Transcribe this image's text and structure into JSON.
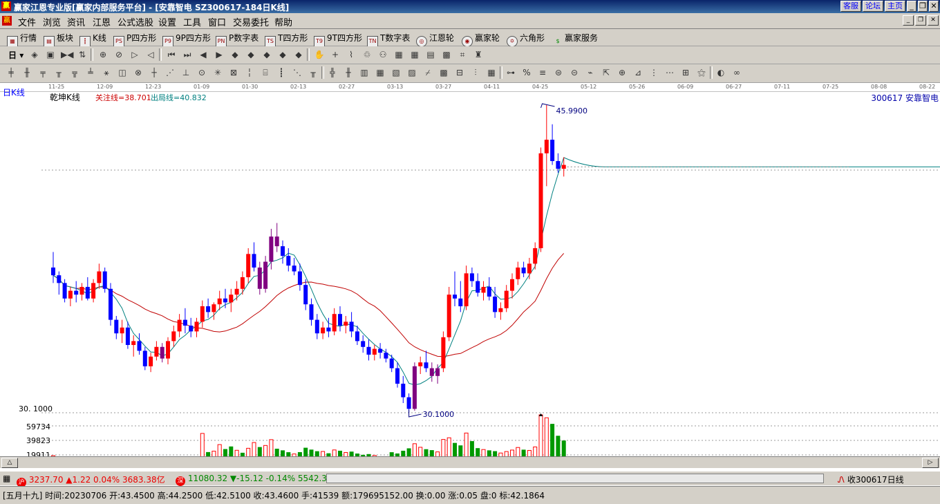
{
  "window": {
    "title": "赢家江恩专业版[赢家内部服务平台] - [安靠智电  SZ300617-184日K线]",
    "right_buttons": [
      "客服",
      "论坛",
      "主页"
    ]
  },
  "menu": [
    "文件",
    "浏览",
    "资讯",
    "江恩",
    "公式选股",
    "设置",
    "工具",
    "窗口",
    "交易委托",
    "帮助"
  ],
  "toolbar1": [
    "行情",
    "板块",
    "K线",
    "P四方形",
    "9P四方形",
    "P数字表",
    "T四方形",
    "9T四方形",
    "T数字表",
    "江恩轮",
    "赢家轮",
    "六角形",
    "赢家服务"
  ],
  "toolbar1_icons": [
    "grid-icon",
    "blocks-icon",
    "kline-icon",
    "p-square-icon",
    "9p-square-icon",
    "p-number-icon",
    "t-square-icon",
    "9t-square-icon",
    "t-number-icon",
    "gann-wheel-icon",
    "winner-wheel-icon",
    "hexagon-icon",
    "service-icon"
  ],
  "toolbar2": {
    "period": "日"
  },
  "dates": [
    "11-25",
    "12-09",
    "12-23",
    "01-09",
    "01-30",
    "02-13",
    "02-27",
    "03-13",
    "03-27",
    "04-11",
    "04-25",
    "05-12",
    "05-26",
    "06-09",
    "06-27",
    "07-11",
    "07-25",
    "08-08",
    "08-22"
  ],
  "chart": {
    "period_label": "日K线",
    "style_label": "乾坤K线",
    "attention_line": "关注线=38.701",
    "exit_line": "出局线=40.832",
    "stock": "300617 安靠智电",
    "high_label": "45.9900",
    "low_label": "30.1000",
    "low_axis_label": "30. 1000",
    "vol_ticks": [
      "59734",
      "39823",
      "19911"
    ]
  },
  "colors": {
    "up": "#ff0000",
    "down": "#0000ff",
    "neutral": "#800080",
    "ma_long": "#c00000",
    "ma_short": "#008080",
    "vol_up": "#ff0000",
    "vol_down": "#009900"
  },
  "chart_data": {
    "type": "candlestick",
    "price_range": [
      30.1,
      45.99
    ],
    "ma_labels": {
      "attention": 38.701,
      "exit": 40.832
    },
    "candles": [
      [
        37.6,
        38.4,
        36.8,
        37.2
      ],
      [
        37.2,
        37.4,
        36.2,
        36.8
      ],
      [
        36.8,
        37.0,
        35.8,
        36.0
      ],
      [
        36.0,
        36.6,
        35.6,
        36.4
      ],
      [
        36.4,
        36.9,
        35.8,
        36.2
      ],
      [
        36.2,
        36.8,
        35.9,
        36.6
      ],
      [
        36.6,
        37.1,
        35.9,
        36.0
      ],
      [
        36.0,
        37.0,
        35.8,
        36.8
      ],
      [
        36.8,
        37.8,
        36.5,
        37.4
      ],
      [
        37.4,
        37.6,
        36.3,
        36.5
      ],
      [
        36.5,
        36.8,
        34.6,
        34.9
      ],
      [
        34.9,
        35.1,
        33.9,
        34.2
      ],
      [
        34.2,
        34.9,
        33.7,
        34.5
      ],
      [
        34.5,
        34.8,
        33.4,
        33.6
      ],
      [
        33.6,
        34.1,
        33.0,
        33.8
      ],
      [
        33.8,
        34.2,
        33.1,
        33.3
      ],
      [
        33.3,
        33.5,
        32.3,
        32.5
      ],
      [
        32.5,
        33.2,
        32.2,
        33.0
      ],
      [
        33.0,
        33.8,
        32.8,
        33.5
      ],
      [
        33.5,
        33.7,
        32.7,
        32.9
      ],
      [
        32.9,
        34.0,
        32.6,
        33.8
      ],
      [
        33.8,
        34.6,
        33.5,
        34.3
      ],
      [
        34.3,
        35.2,
        34.0,
        34.9
      ],
      [
        34.9,
        35.5,
        34.2,
        34.6
      ],
      [
        34.6,
        35.0,
        34.0,
        34.3
      ],
      [
        34.3,
        35.0,
        34.0,
        34.8
      ],
      [
        34.8,
        35.9,
        34.5,
        35.6
      ],
      [
        35.6,
        36.0,
        35.0,
        35.3
      ],
      [
        35.3,
        35.8,
        34.9,
        35.7
      ],
      [
        35.7,
        36.4,
        35.4,
        36.0
      ],
      [
        36.0,
        36.5,
        35.5,
        35.8
      ],
      [
        35.8,
        36.5,
        35.3,
        36.2
      ],
      [
        36.2,
        36.9,
        35.9,
        36.5
      ],
      [
        36.5,
        37.4,
        36.2,
        37.1
      ],
      [
        37.1,
        38.6,
        36.8,
        38.3
      ],
      [
        38.3,
        38.9,
        37.4,
        37.6
      ],
      [
        37.6,
        37.9,
        36.2,
        36.5
      ],
      [
        36.5,
        38.2,
        36.3,
        37.9
      ],
      [
        37.9,
        39.6,
        37.5,
        39.2
      ],
      [
        39.2,
        39.9,
        38.4,
        38.7
      ],
      [
        38.7,
        39.0,
        37.8,
        38.2
      ],
      [
        38.2,
        38.6,
        37.4,
        37.7
      ],
      [
        37.7,
        38.1,
        37.2,
        37.4
      ],
      [
        37.4,
        37.8,
        36.4,
        36.7
      ],
      [
        36.7,
        37.0,
        35.4,
        35.7
      ],
      [
        35.7,
        36.0,
        34.6,
        34.9
      ],
      [
        34.9,
        35.2,
        33.9,
        34.2
      ],
      [
        34.2,
        34.8,
        33.9,
        34.5
      ],
      [
        34.5,
        35.0,
        34.0,
        34.3
      ],
      [
        34.3,
        35.5,
        34.1,
        35.2
      ],
      [
        35.2,
        35.6,
        34.3,
        34.6
      ],
      [
        34.6,
        35.1,
        34.2,
        34.8
      ],
      [
        34.8,
        35.3,
        34.0,
        34.3
      ],
      [
        34.3,
        34.6,
        33.6,
        33.8
      ],
      [
        33.8,
        34.1,
        33.2,
        33.5
      ],
      [
        33.5,
        33.9,
        32.8,
        33.1
      ],
      [
        33.1,
        33.6,
        32.8,
        33.4
      ],
      [
        33.4,
        33.7,
        32.9,
        33.2
      ],
      [
        33.2,
        33.4,
        32.7,
        32.9
      ],
      [
        32.9,
        33.1,
        32.2,
        32.4
      ],
      [
        32.4,
        32.7,
        31.4,
        31.6
      ],
      [
        31.6,
        32.0,
        30.6,
        30.9
      ],
      [
        30.9,
        31.1,
        30.1,
        30.3
      ],
      [
        30.3,
        32.7,
        30.2,
        32.5
      ],
      [
        32.5,
        33.0,
        32.1,
        32.7
      ],
      [
        32.7,
        33.3,
        32.2,
        32.4
      ],
      [
        32.4,
        32.7,
        31.7,
        32.0
      ],
      [
        32.0,
        32.6,
        31.6,
        32.4
      ],
      [
        32.4,
        34.3,
        32.2,
        34.0
      ],
      [
        34.0,
        36.6,
        33.8,
        36.2
      ],
      [
        36.2,
        37.4,
        35.6,
        36.0
      ],
      [
        36.0,
        36.9,
        35.3,
        35.6
      ],
      [
        35.6,
        37.7,
        35.4,
        37.3
      ],
      [
        37.3,
        37.6,
        36.6,
        36.9
      ],
      [
        36.9,
        37.3,
        36.1,
        36.3
      ],
      [
        36.3,
        36.9,
        35.9,
        36.6
      ],
      [
        36.6,
        37.1,
        35.9,
        36.1
      ],
      [
        36.1,
        36.6,
        35.0,
        35.3
      ],
      [
        35.3,
        35.8,
        34.9,
        35.5
      ],
      [
        35.5,
        36.7,
        35.3,
        36.4
      ],
      [
        36.4,
        37.3,
        36.0,
        37.0
      ],
      [
        37.0,
        37.9,
        36.7,
        37.6
      ],
      [
        37.6,
        37.9,
        37.1,
        37.3
      ],
      [
        37.3,
        38.1,
        37.0,
        37.8
      ],
      [
        37.8,
        38.9,
        37.5,
        38.6
      ],
      [
        38.6,
        43.8,
        38.4,
        43.5
      ],
      [
        43.5,
        45.99,
        41.8,
        44.2
      ],
      [
        44.2,
        45.0,
        42.9,
        43.1
      ],
      [
        43.1,
        43.5,
        42.5,
        42.7
      ],
      [
        42.7,
        43.3,
        42.3,
        42.9
      ]
    ],
    "volume_max": 79646,
    "volumes": [
      [
        18500,
        1
      ],
      [
        15200,
        0
      ],
      [
        13800,
        0
      ],
      [
        12500,
        1
      ],
      [
        11000,
        0
      ],
      [
        13200,
        1
      ],
      [
        12100,
        0
      ],
      [
        15500,
        1
      ],
      [
        16800,
        1
      ],
      [
        14600,
        0
      ],
      [
        15800,
        0
      ],
      [
        14300,
        0
      ],
      [
        13900,
        1
      ],
      [
        14100,
        0
      ],
      [
        12400,
        1
      ],
      [
        15000,
        0
      ],
      [
        14700,
        0
      ],
      [
        13100,
        1
      ],
      [
        13600,
        1
      ],
      [
        11900,
        0
      ],
      [
        15600,
        1
      ],
      [
        16400,
        1
      ],
      [
        14900,
        1
      ],
      [
        13500,
        0
      ],
      [
        12300,
        0
      ],
      [
        14400,
        1
      ],
      [
        51800,
        1
      ],
      [
        23900,
        0
      ],
      [
        25300,
        1
      ],
      [
        35100,
        1
      ],
      [
        28400,
        0
      ],
      [
        32300,
        0
      ],
      [
        26600,
        1
      ],
      [
        22900,
        0
      ],
      [
        29600,
        1
      ],
      [
        38200,
        1
      ],
      [
        31400,
        0
      ],
      [
        33800,
        1
      ],
      [
        42500,
        1
      ],
      [
        28900,
        0
      ],
      [
        26500,
        0
      ],
      [
        23700,
        0
      ],
      [
        21100,
        1
      ],
      [
        23800,
        0
      ],
      [
        30400,
        0
      ],
      [
        27600,
        0
      ],
      [
        25200,
        0
      ],
      [
        24800,
        1
      ],
      [
        22100,
        0
      ],
      [
        27100,
        1
      ],
      [
        25900,
        0
      ],
      [
        23300,
        1
      ],
      [
        24600,
        0
      ],
      [
        21700,
        0
      ],
      [
        19800,
        0
      ],
      [
        20900,
        0
      ],
      [
        18800,
        1
      ],
      [
        17400,
        0
      ],
      [
        16300,
        0
      ],
      [
        23700,
        0
      ],
      [
        21800,
        0
      ],
      [
        25900,
        0
      ],
      [
        29500,
        0
      ],
      [
        36400,
        1
      ],
      [
        31100,
        1
      ],
      [
        28200,
        0
      ],
      [
        26800,
        0
      ],
      [
        24200,
        1
      ],
      [
        42800,
        1
      ],
      [
        45300,
        1
      ],
      [
        37600,
        0
      ],
      [
        33900,
        0
      ],
      [
        52400,
        1
      ],
      [
        40300,
        0
      ],
      [
        29800,
        0
      ],
      [
        27700,
        1
      ],
      [
        26500,
        0
      ],
      [
        25300,
        0
      ],
      [
        22500,
        1
      ],
      [
        24700,
        1
      ],
      [
        26900,
        1
      ],
      [
        30800,
        1
      ],
      [
        27500,
        0
      ],
      [
        26400,
        1
      ],
      [
        31600,
        1
      ],
      [
        79646,
        1
      ],
      [
        75200,
        1
      ],
      [
        66100,
        0
      ],
      [
        48300,
        0
      ],
      [
        41200,
        0
      ]
    ]
  },
  "status": {
    "sh_icon": "沪",
    "sh_index": "3237.70",
    "sh_change": "▲1.22 0.04% 3683.38亿",
    "sz_icon": "深",
    "sz_index": "11080.32",
    "sz_change": "▼-15.12 -0.14% 5542.3",
    "right_info": "收300617日线"
  },
  "info": "[五月十九] 时间:20230706 开:43.4500 高:44.2500 低:42.5100 收:43.4600 手:41539 额:179695152.00 换:0.00 涨:0.05 盘:0 标:42.1864"
}
